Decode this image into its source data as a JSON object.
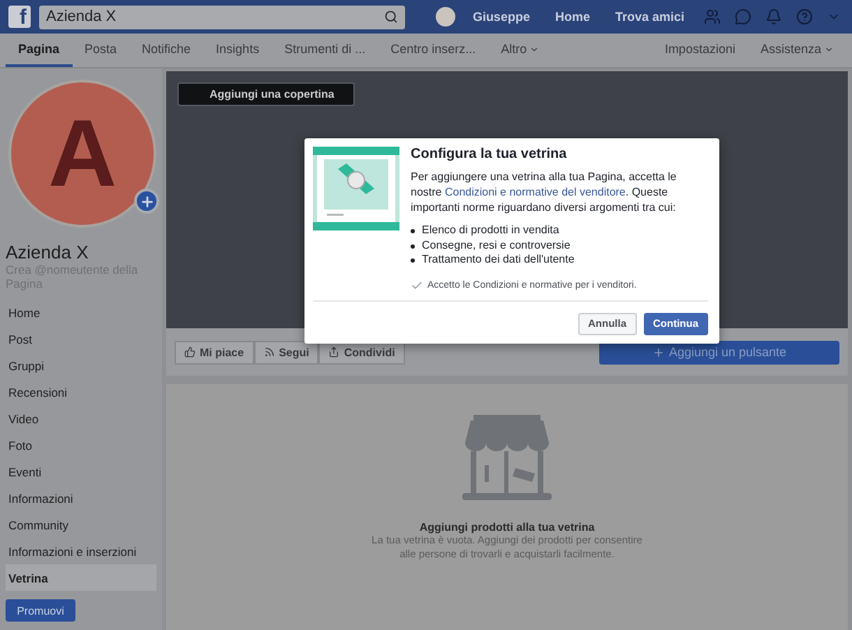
{
  "top_bar": {
    "logo": "f",
    "search_value": "Azienda X",
    "user": "Giuseppe",
    "links": [
      "Home",
      "Trova amici"
    ]
  },
  "page_tabs": [
    {
      "label": "Pagina",
      "selected": true,
      "dropdown": false
    },
    {
      "label": "Posta",
      "selected": false,
      "dropdown": false
    },
    {
      "label": "Notifiche",
      "selected": false,
      "dropdown": false
    },
    {
      "label": "Insights",
      "selected": false,
      "dropdown": false
    },
    {
      "label": "Strumenti di ...",
      "selected": false,
      "dropdown": false
    },
    {
      "label": "Centro inserz...",
      "selected": false,
      "dropdown": false
    },
    {
      "label": "Altro",
      "selected": false,
      "dropdown": true
    }
  ],
  "page_tabs_right": [
    {
      "label": "Impostazioni",
      "dropdown": false
    },
    {
      "label": "Assistenza",
      "dropdown": true
    }
  ],
  "profile": {
    "letter": "A",
    "name": "Azienda X",
    "username_hint": "Crea @nomeutente della Pagina"
  },
  "sidebar": {
    "items": [
      {
        "label": "Home",
        "selected": false
      },
      {
        "label": "Post",
        "selected": false
      },
      {
        "label": "Gruppi",
        "selected": false
      },
      {
        "label": "Recensioni",
        "selected": false
      },
      {
        "label": "Video",
        "selected": false
      },
      {
        "label": "Foto",
        "selected": false
      },
      {
        "label": "Eventi",
        "selected": false
      },
      {
        "label": "Informazioni",
        "selected": false
      },
      {
        "label": "Community",
        "selected": false
      },
      {
        "label": "Informazioni e inserzioni",
        "selected": false
      },
      {
        "label": "Vetrina",
        "selected": true
      }
    ],
    "promote_button": "Promuovi"
  },
  "cover": {
    "button": "Aggiungi una copertina"
  },
  "actions": [
    {
      "kind": "like",
      "label": "Mi piace"
    },
    {
      "kind": "follow",
      "label": "Segui"
    },
    {
      "kind": "share",
      "label": "Condividi"
    }
  ],
  "add_button": "Aggiungi un pulsante",
  "shop_empty": {
    "title": "Aggiungi prodotti alla tua vetrina",
    "text": "La tua vetrina è vuota. Aggiungi dei prodotti per consentire alle persone di trovarli e acquistarli facilmente."
  },
  "dialog": {
    "title": "Configura la tua vetrina",
    "intro_before": "Per aggiungere una vetrina alla tua Pagina, accetta le nostre ",
    "intro_link": "Condizioni e normative del venditore",
    "intro_after": ". Queste importanti norme riguardano diversi argomenti tra cui:",
    "bullets": [
      "Elenco di prodotti in vendita",
      "Consegne, resi e controversie",
      "Trattamento dei dati dell'utente"
    ],
    "agree": {
      "label": "Accetto le Condizioni e normative per i venditori.",
      "checked": true
    },
    "cancel": "Annulla",
    "confirm": "Continua"
  }
}
